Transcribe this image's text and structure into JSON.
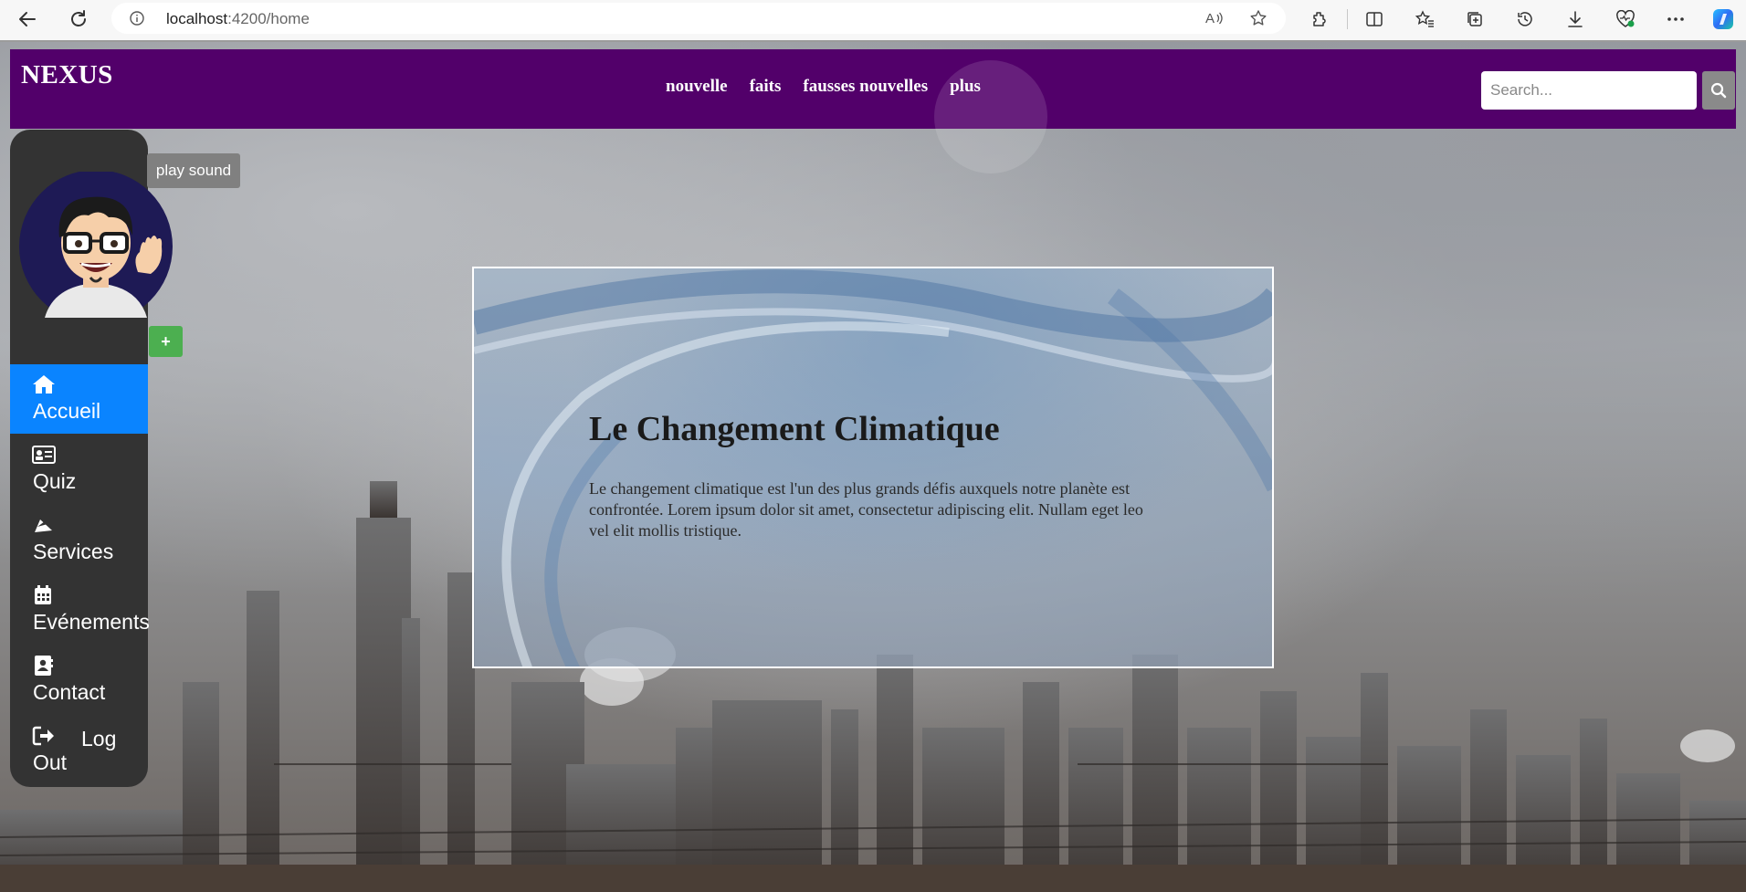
{
  "browser": {
    "url_host": "localhost",
    "url_path": ":4200/home",
    "icons": [
      "back-icon",
      "refresh-icon",
      "info-icon",
      "read-aloud-icon",
      "favorite-star-icon",
      "extensions-icon",
      "split-screen-icon",
      "favorites-icon",
      "collections-icon",
      "history-icon",
      "downloads-icon",
      "browser-essentials-icon",
      "more-icon",
      "copilot-icon"
    ]
  },
  "header": {
    "brand": "NEXUS",
    "nav": [
      "nouvelle",
      "faits",
      "fausses nouvelles",
      "plus"
    ],
    "search_placeholder": "Search...",
    "search_icon": "search-icon"
  },
  "colors": {
    "header_bg": "#52006a",
    "sidebar_bg": "#333333",
    "active_item": "#0a84ff",
    "add_button": "#4caf50",
    "play_sound_bg": "#808080"
  },
  "sidebar": {
    "play_sound": "play sound",
    "add_label": "+",
    "items": [
      {
        "label": "Accueil",
        "icon": "home-icon"
      },
      {
        "label": "Quiz",
        "icon": "id-card-icon"
      },
      {
        "label": "Services",
        "icon": "services-icon"
      },
      {
        "label": "Evénements",
        "icon": "calendar-icon"
      },
      {
        "label": "Contact",
        "icon": "address-book-icon"
      }
    ],
    "logout": {
      "line1": "Log",
      "line2": "Out",
      "icon": "sign-out-icon"
    }
  },
  "card": {
    "title": "Le Changement Climatique",
    "text": "Le changement climatique est l'un des plus grands défis auxquels notre planète est confrontée. Lorem ipsum dolor sit amet, consectetur adipiscing elit. Nullam eget leo vel elit mollis tristique."
  }
}
